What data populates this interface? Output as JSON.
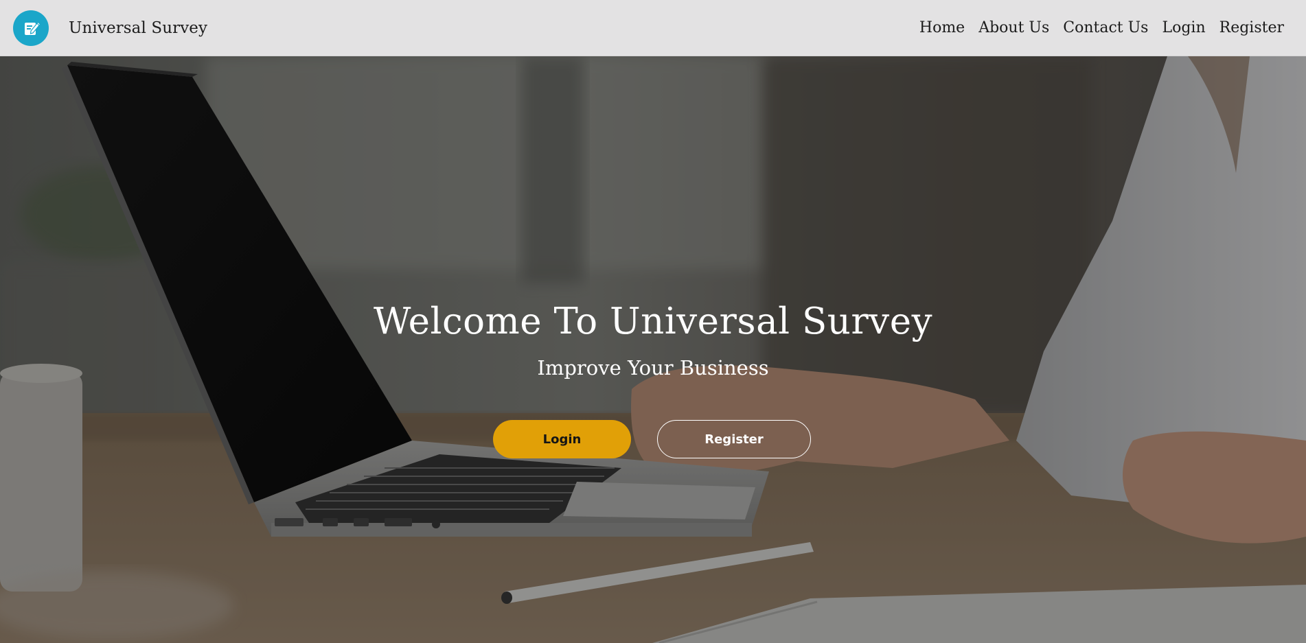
{
  "brand": {
    "name": "Universal Survey",
    "logo_icon": "edit-note-icon",
    "logo_color": "#1ba6c9"
  },
  "nav": {
    "items": [
      {
        "label": "Home"
      },
      {
        "label": "About Us"
      },
      {
        "label": "Contact Us"
      },
      {
        "label": "Login"
      },
      {
        "label": "Register"
      }
    ]
  },
  "hero": {
    "title": "Welcome To Universal Survey",
    "subtitle": "Improve Your Business",
    "login_label": "Login",
    "register_label": "Register",
    "accent_color": "#e1a007"
  }
}
